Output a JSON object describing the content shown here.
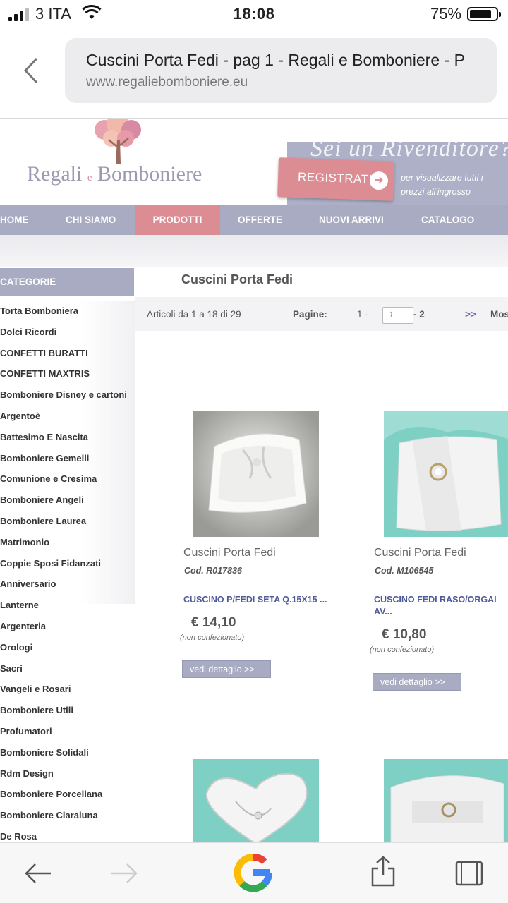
{
  "status": {
    "carrier": "3 ITA",
    "time": "18:08",
    "battery": "75%",
    "battery_level": 0.75
  },
  "browser": {
    "title": "Cuscini Porta Fedi - pag 1 - Regali e Bomboniere - P",
    "host": "www.regaliebomboniere.eu"
  },
  "header": {
    "brand_a": "Regali",
    "brand_e": "e",
    "brand_b": "Bomboniere",
    "tagline": "Sei un Rivenditore?",
    "register": "REGISTRATI",
    "promo_text": "per visualizzare tutti i prezzi all'ingrosso"
  },
  "nav": [
    "HOME",
    "CHI SIAMO",
    "PRODOTTI",
    "OFFERTE",
    "NUOVI ARRIVI",
    "CATALOGO"
  ],
  "sidebar": {
    "heading": "CATEGORIE",
    "items": [
      "Torta Bomboniera",
      "Dolci Ricordi",
      "CONFETTI BURATTI",
      "CONFETTI MAXTRIS",
      "Bomboniere Disney e cartoni",
      "Argentoè",
      "Battesimo E Nascita",
      "Bomboniere Gemelli",
      "Comunione e Cresima",
      "Bomboniere Angeli",
      "Bomboniere Laurea",
      "Matrimonio",
      "Coppie Sposi Fidanzati",
      "Anniversario",
      "Lanterne",
      "Argenteria",
      "Orologi",
      "Sacri",
      "Vangeli e Rosari",
      "Bomboniere Utili",
      "Profumatori",
      "Bomboniere Solidali",
      "Rdm Design",
      "Bomboniere Porcellana",
      "Bomboniere Claraluna",
      "De Rosa"
    ]
  },
  "main": {
    "title": "Cuscini Porta Fedi",
    "pager": {
      "count": "Articoli da 1 a 18 di 29",
      "label": "Pagine:",
      "p1": "1 -",
      "input_value": "1",
      "p2": "- 2",
      "next": ">>",
      "more": "Mos"
    }
  },
  "products": [
    {
      "name": "Cuscini Porta Fedi",
      "code": "Cod. R017836",
      "desc": "CUSCINO P/FEDI SETA Q.15X15 ...",
      "price": "€ 14,10",
      "note": "(non confezionato)",
      "button": "vedi dettaglio >>"
    },
    {
      "name": "Cuscini Porta Fedi",
      "code": "Cod. M106545",
      "desc": "CUSCINO FEDI RASO/ORGAI AV...",
      "price": "€ 10,80",
      "note": "(non confezionato)",
      "button": "vedi dettaglio >>"
    }
  ]
}
